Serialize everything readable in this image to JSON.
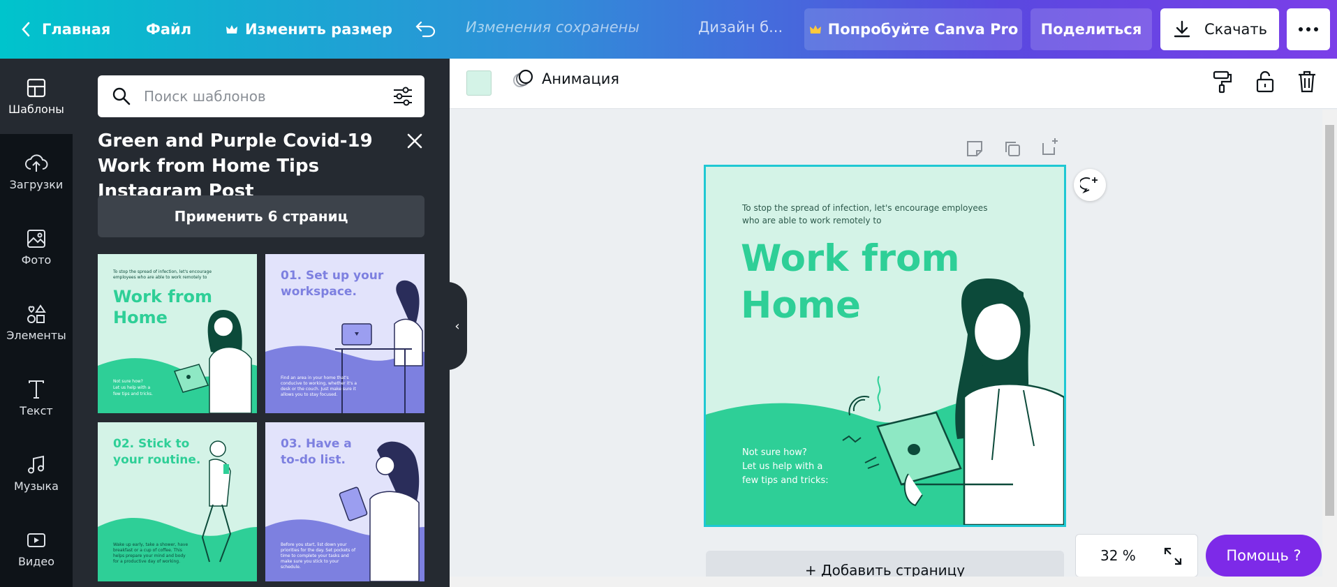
{
  "topbar": {
    "home_label": "Главная",
    "file_label": "Файл",
    "resize_label": "Изменить размер",
    "saved_status": "Изменения сохранены",
    "design_name": "Дизайн б...",
    "pro_label": "Попробуйте Canva Pro",
    "share_label": "Поделиться",
    "download_label": "Скачать"
  },
  "rail": {
    "items": [
      {
        "label": "Шаблоны",
        "icon": "templates-icon"
      },
      {
        "label": "Загрузки",
        "icon": "upload-cloud-icon"
      },
      {
        "label": "Фото",
        "icon": "photo-icon"
      },
      {
        "label": "Элементы",
        "icon": "elements-icon"
      },
      {
        "label": "Текст",
        "icon": "text-icon"
      },
      {
        "label": "Музыка",
        "icon": "music-icon"
      },
      {
        "label": "Видео",
        "icon": "video-icon"
      }
    ]
  },
  "panel": {
    "search_placeholder": "Поиск шаблонов",
    "template_title": "Green and Purple Covid-19 Work from Home Tips Instagram Post",
    "apply_label": "Применить 6 страниц",
    "thumbs": [
      {
        "heading": "Work from\nHome",
        "small": "To stop the spread of infection, let's encourage employees who are able to work remotely to",
        "foot": "Not sure how?\nLet us help with a\nfew tips and tricks.",
        "theme": "green"
      },
      {
        "heading": "01. Set up your\nworkspace.",
        "small": "",
        "foot": "Find an area in your home that's conducive to working, whether it's a desk or the couch. Just make sure it allows you to stay focused.",
        "theme": "purple"
      },
      {
        "heading": "02. Stick to\nyour routine.",
        "small": "",
        "foot": "Wake up early, take a shower, have breakfast or a cup of coffee. This helps prepare your mind and body for a productive day of working.",
        "theme": "green"
      },
      {
        "heading": "03. Have a\nto-do list.",
        "small": "",
        "foot": "Before you start, list down your priorities for the day. Set pockets of time to complete your tasks and make sure you stick to your schedule.",
        "theme": "purple"
      }
    ]
  },
  "context_bar": {
    "swatch_color": "#d4f3e7",
    "animation_label": "Анимация"
  },
  "artboard": {
    "intro": "To stop the spread of infection, let's encourage employees\nwho are able to work remotely to",
    "heading": "Work from\nHome",
    "footer": "Not sure how?\nLet us help with a\nfew tips and tricks:",
    "colors": {
      "bg": "#d4f3e7",
      "accent": "#2ecf97",
      "dark": "#0c4a3a"
    }
  },
  "add_page_label": "+ Добавить страницу",
  "zoom": {
    "value": "32 %"
  },
  "help_label": "Помощь ?"
}
